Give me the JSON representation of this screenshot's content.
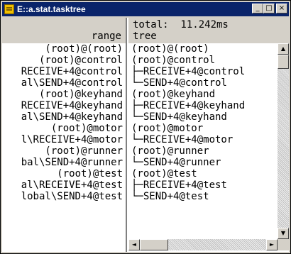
{
  "window": {
    "title": "E::a.stat.tasktree",
    "buttons": {
      "minimize": "_",
      "maximize": "□",
      "close": "×"
    }
  },
  "header": {
    "total_label": "total:  11.242ms",
    "range_label": "range",
    "tree_label": "tree"
  },
  "rows": [
    {
      "range": "(root)@(root)",
      "tree": "(root)@(root)"
    },
    {
      "range": "(root)@control",
      "tree": "(root)@control"
    },
    {
      "range": "RECEIVE+4@control",
      "tree": "├─RECEIVE+4@control"
    },
    {
      "range": "al\\SEND+4@control",
      "tree": "└─SEND+4@control"
    },
    {
      "range": "(root)@keyhand",
      "tree": "(root)@keyhand"
    },
    {
      "range": "RECEIVE+4@keyhand",
      "tree": "├─RECEIVE+4@keyhand"
    },
    {
      "range": "al\\SEND+4@keyhand",
      "tree": "└─SEND+4@keyhand"
    },
    {
      "range": "(root)@motor",
      "tree": "(root)@motor"
    },
    {
      "range": "l\\RECEIVE+4@motor",
      "tree": "└─RECEIVE+4@motor"
    },
    {
      "range": "(root)@runner",
      "tree": "(root)@runner"
    },
    {
      "range": "bal\\SEND+4@runner",
      "tree": "└─SEND+4@runner"
    },
    {
      "range": "(root)@test",
      "tree": "(root)@test"
    },
    {
      "range": "al\\RECEIVE+4@test",
      "tree": "├─RECEIVE+4@test"
    },
    {
      "range": "lobal\\SEND+4@test",
      "tree": "└─SEND+4@test"
    }
  ],
  "icons": {
    "app": "task-tree-icon",
    "scroll_up": "▲",
    "scroll_down": "▼",
    "scroll_left": "◄",
    "scroll_right": "►"
  },
  "colors": {
    "titlebar": "#0a246a",
    "face": "#d4d0c8"
  }
}
